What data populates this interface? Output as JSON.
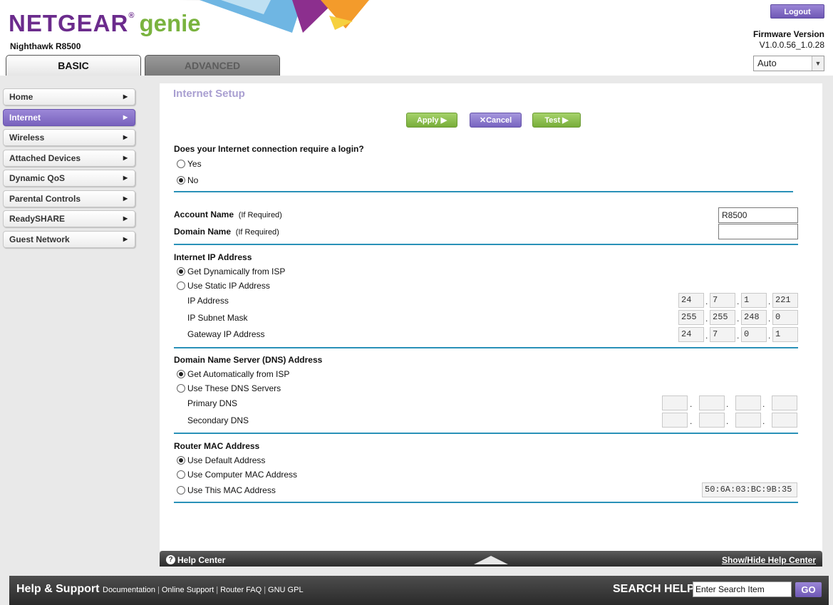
{
  "header": {
    "brand_name": "NETGEAR",
    "brand_registered": "®",
    "brand_product": "genie",
    "model": "Nighthawk R8500",
    "logout_label": "Logout",
    "firmware_label": "Firmware Version",
    "firmware_value": "V1.0.0.56_1.0.28",
    "language_value": "Auto"
  },
  "tabs": [
    {
      "label": "BASIC",
      "active": true
    },
    {
      "label": "ADVANCED",
      "active": false
    }
  ],
  "sidebar": {
    "items": [
      {
        "label": "Home"
      },
      {
        "label": "Internet",
        "active": true
      },
      {
        "label": "Wireless"
      },
      {
        "label": "Attached Devices"
      },
      {
        "label": "Dynamic QoS"
      },
      {
        "label": "Parental Controls"
      },
      {
        "label": "ReadySHARE"
      },
      {
        "label": "Guest Network"
      }
    ]
  },
  "page": {
    "title": "Internet Setup",
    "buttons": {
      "apply": "Apply ▶",
      "cancel": "Cancel",
      "test": "Test ▶"
    }
  },
  "login_question": {
    "label": "Does your Internet connection require a login?",
    "options": [
      "Yes",
      "No"
    ],
    "selected": "No"
  },
  "account": {
    "account_label": "Account Name",
    "domain_label": "Domain Name",
    "if_required": "(If Required)",
    "account_value": "R8500",
    "domain_value": ""
  },
  "internet_ip": {
    "heading": "Internet IP Address",
    "options": [
      "Get Dynamically from ISP",
      "Use Static IP Address"
    ],
    "selected": "Get Dynamically from ISP",
    "ip_label": "IP Address",
    "ip": [
      "24",
      "7",
      "1",
      "221"
    ],
    "subnet_label": "IP Subnet Mask",
    "subnet": [
      "255",
      "255",
      "248",
      "0"
    ],
    "gateway_label": "Gateway IP Address",
    "gateway": [
      "24",
      "7",
      "0",
      "1"
    ]
  },
  "dns": {
    "heading": "Domain Name Server (DNS) Address",
    "options": [
      "Get Automatically from ISP",
      "Use These DNS Servers"
    ],
    "selected": "Get Automatically from ISP",
    "primary_label": "Primary DNS",
    "secondary_label": "Secondary DNS"
  },
  "mac": {
    "heading": "Router MAC Address",
    "options": [
      "Use Default Address",
      "Use Computer MAC Address",
      "Use This MAC Address"
    ],
    "selected": "Use Default Address",
    "value": "50:6A:03:BC:9B:35"
  },
  "help_center": {
    "label": "Help Center",
    "toggle": "Show/Hide Help Center"
  },
  "footer": {
    "title": "Help & Support",
    "links": [
      "Documentation",
      "Online Support",
      "Router FAQ",
      "GNU GPL"
    ],
    "search_label": "SEARCH HELP",
    "search_placeholder": "Enter Search Item",
    "go_label": "GO"
  },
  "colors": {
    "brand_purple": "#6b2b8c",
    "brand_green": "#7ab33f",
    "accent_purple": "#7862bd",
    "section_rule": "#2a91b8"
  }
}
